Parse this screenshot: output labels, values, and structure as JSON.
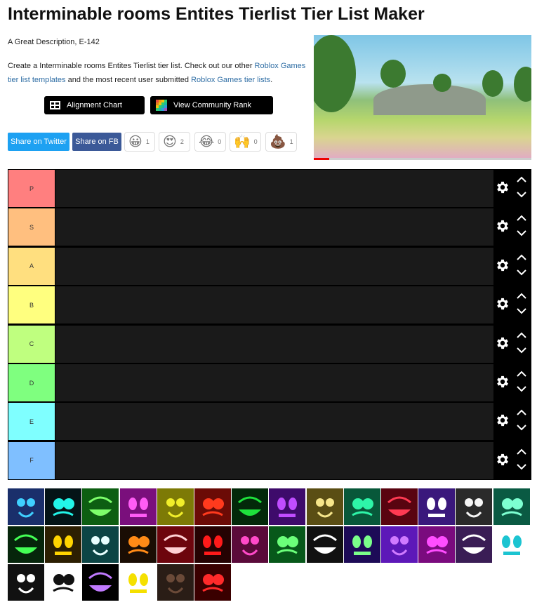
{
  "page": {
    "title": "Interminable rooms Entites Tierlist Tier List Maker",
    "description": "A Great Description, E-142",
    "intro_prefix": "Create a Interminable rooms Entites Tierlist tier list. Check out our other ",
    "intro_link1": "Roblox Games tier list templates",
    "intro_middle": " and the most recent user submitted ",
    "intro_link2": "Roblox Games tier lists",
    "intro_suffix": "."
  },
  "buttons": {
    "alignment_chart": "Alignment Chart",
    "community_rank": "View Community Rank",
    "share_twitter": "Share on Twitter",
    "share_fb": "Share on FB"
  },
  "reactions": [
    {
      "emoji": "😀",
      "count": "1"
    },
    {
      "emoji": "😍",
      "count": "2"
    },
    {
      "emoji": "😂",
      "count": "0"
    },
    {
      "emoji": "🙌",
      "count": "0"
    },
    {
      "emoji": "💩",
      "count": "1"
    }
  ],
  "tiers": [
    {
      "label": "P",
      "color": "#ff7f7f"
    },
    {
      "label": "S",
      "color": "#ffbf7f"
    },
    {
      "label": "A",
      "color": "#ffdf7f"
    },
    {
      "label": "B",
      "color": "#ffff7f"
    },
    {
      "label": "C",
      "color": "#bfff7f"
    },
    {
      "label": "D",
      "color": "#7fff7f"
    },
    {
      "label": "E",
      "color": "#7fffff"
    },
    {
      "label": "F",
      "color": "#7fbfff"
    }
  ],
  "entities": [
    {
      "name": "entity-1",
      "bg": "#1a2f6b",
      "fg": "#3fd0ff"
    },
    {
      "name": "entity-2",
      "bg": "#041417",
      "fg": "#22f5e8"
    },
    {
      "name": "entity-3",
      "bg": "#0d5e12",
      "fg": "#7dff6b"
    },
    {
      "name": "entity-4",
      "bg": "#7a0f7c",
      "fg": "#ff5cf5"
    },
    {
      "name": "entity-5",
      "bg": "#7d7a06",
      "fg": "#f1ee2a"
    },
    {
      "name": "entity-6",
      "bg": "#6b0b06",
      "fg": "#ff3a1d"
    },
    {
      "name": "entity-7",
      "bg": "#03290a",
      "fg": "#1ee23c"
    },
    {
      "name": "entity-8",
      "bg": "#3e0b6b",
      "fg": "#c04dff"
    },
    {
      "name": "entity-9",
      "bg": "#5a4e14",
      "fg": "#f6e68a"
    },
    {
      "name": "entity-10",
      "bg": "#08583a",
      "fg": "#2ef5a8"
    },
    {
      "name": "entity-11",
      "bg": "#590410",
      "fg": "#ff3a52"
    },
    {
      "name": "entity-12",
      "bg": "#3a187c",
      "fg": "#ffffff"
    },
    {
      "name": "entity-13",
      "bg": "#2a2a2a",
      "fg": "#f5f5f5"
    },
    {
      "name": "entity-14",
      "bg": "#0a5a43",
      "fg": "#7dffd1"
    },
    {
      "name": "entity-15",
      "bg": "#06250b",
      "fg": "#44ff55"
    },
    {
      "name": "entity-16",
      "bg": "#2c1f02",
      "fg": "#ffd400"
    },
    {
      "name": "entity-17",
      "bg": "#0c4545",
      "fg": "#e8ffff"
    },
    {
      "name": "entity-18",
      "bg": "#1a0d04",
      "fg": "#ff8a17"
    },
    {
      "name": "entity-19",
      "bg": "#6d050d",
      "fg": "#ffd0d4"
    },
    {
      "name": "entity-20",
      "bg": "#250202",
      "fg": "#ff1a1a"
    },
    {
      "name": "entity-21",
      "bg": "#5a0a3a",
      "fg": "#ff49c9"
    },
    {
      "name": "entity-22",
      "bg": "#07581a",
      "fg": "#6bff7a"
    },
    {
      "name": "entity-23",
      "bg": "#111111",
      "fg": "#ffffff"
    },
    {
      "name": "entity-24",
      "bg": "#1d0b57",
      "fg": "#7aff8a"
    },
    {
      "name": "entity-25",
      "bg": "#5d18b8",
      "fg": "#d07aff"
    },
    {
      "name": "entity-26",
      "bg": "#7a0b7e",
      "fg": "#ff4dff"
    },
    {
      "name": "entity-27",
      "bg": "#3a1d55",
      "fg": "#ffffff"
    },
    {
      "name": "entity-28",
      "bg": "#ffffff",
      "fg": "#1cc4d1"
    },
    {
      "name": "entity-29",
      "bg": "#111111",
      "fg": "#ffffff"
    },
    {
      "name": "entity-30",
      "bg": "#ffffff",
      "fg": "#111111"
    },
    {
      "name": "entity-31",
      "bg": "#000000",
      "fg": "#c07aff"
    },
    {
      "name": "entity-32",
      "bg": "#ffffff",
      "fg": "#f5e000"
    },
    {
      "name": "entity-33",
      "bg": "#2a1d16",
      "fg": "#6b4a38"
    },
    {
      "name": "entity-34",
      "bg": "#3a0000",
      "fg": "#ff2a2a"
    }
  ],
  "colors": {
    "link": "#2e6da4",
    "twitter": "#1da1f2",
    "facebook": "#3b5998",
    "tier_bg": "#1a1a1a"
  },
  "icons": {
    "alignment": "grid-icon",
    "community": "color-grid-icon",
    "settings": "gear-icon",
    "move_up": "chevron-up-icon",
    "move_down": "chevron-down-icon"
  }
}
